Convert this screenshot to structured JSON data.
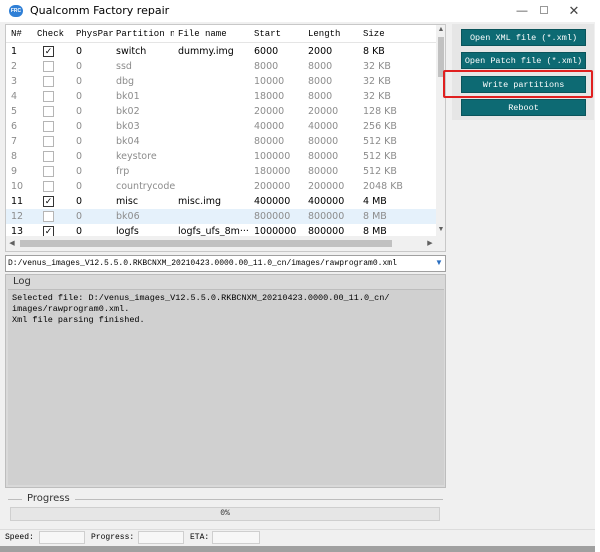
{
  "window": {
    "title": "Qualcomm Factory repair",
    "icon_text": "FRC"
  },
  "table": {
    "headers": [
      "N#",
      "Check",
      "PhysPar",
      "Partition na",
      "File name",
      "Start",
      "Length",
      "Size"
    ],
    "rows": [
      {
        "n": "1",
        "checked": true,
        "phys": "0",
        "name": "switch",
        "file": "dummy.img",
        "start": "6000",
        "length": "2000",
        "size": "8 KB",
        "dim": false
      },
      {
        "n": "2",
        "checked": false,
        "phys": "0",
        "name": "ssd",
        "file": "",
        "start": "8000",
        "length": "8000",
        "size": "32 KB",
        "dim": true
      },
      {
        "n": "3",
        "checked": false,
        "phys": "0",
        "name": "dbg",
        "file": "",
        "start": "10000",
        "length": "8000",
        "size": "32 KB",
        "dim": true
      },
      {
        "n": "4",
        "checked": false,
        "phys": "0",
        "name": "bk01",
        "file": "",
        "start": "18000",
        "length": "8000",
        "size": "32 KB",
        "dim": true
      },
      {
        "n": "5",
        "checked": false,
        "phys": "0",
        "name": "bk02",
        "file": "",
        "start": "20000",
        "length": "20000",
        "size": "128 KB",
        "dim": true
      },
      {
        "n": "6",
        "checked": false,
        "phys": "0",
        "name": "bk03",
        "file": "",
        "start": "40000",
        "length": "40000",
        "size": "256 KB",
        "dim": true
      },
      {
        "n": "7",
        "checked": false,
        "phys": "0",
        "name": "bk04",
        "file": "",
        "start": "80000",
        "length": "80000",
        "size": "512 KB",
        "dim": true
      },
      {
        "n": "8",
        "checked": false,
        "phys": "0",
        "name": "keystore",
        "file": "",
        "start": "100000",
        "length": "80000",
        "size": "512 KB",
        "dim": true
      },
      {
        "n": "9",
        "checked": false,
        "phys": "0",
        "name": "frp",
        "file": "",
        "start": "180000",
        "length": "80000",
        "size": "512 KB",
        "dim": true
      },
      {
        "n": "10",
        "checked": false,
        "phys": "0",
        "name": "countrycode",
        "file": "",
        "start": "200000",
        "length": "200000",
        "size": "2048 KB",
        "dim": true
      },
      {
        "n": "11",
        "checked": true,
        "phys": "0",
        "name": "misc",
        "file": "misc.img",
        "start": "400000",
        "length": "400000",
        "size": "4 MB",
        "dim": false
      },
      {
        "n": "12",
        "checked": false,
        "phys": "0",
        "name": "bk06",
        "file": "",
        "start": "800000",
        "length": "800000",
        "size": "8 MB",
        "dim": true,
        "selected": true
      },
      {
        "n": "13",
        "checked": true,
        "phys": "0",
        "name": "logfs",
        "file": "logfs_ufs_8m···",
        "start": "1000000",
        "length": "800000",
        "size": "8 MB",
        "dim": false
      }
    ]
  },
  "buttons": {
    "open_xml": "Open XML file (*.xml)",
    "open_patch": "Open Patch file (*.xml)",
    "write_partitions": "Write partitions",
    "reboot": "Reboot"
  },
  "path": {
    "value": "D:/venus_images_V12.5.5.0.RKBCNXM_20210423.0000.00_11.0_cn/images/rawprogram0.xml"
  },
  "log": {
    "title": "Log",
    "lines": [
      "Selected file: D:/venus_images_V12.5.5.0.RKBCNXM_20210423.0000.00_11.0_cn/",
      "images/rawprogram0.xml.",
      "Xml file parsing finished."
    ]
  },
  "progress": {
    "title": "Progress",
    "percent": 0,
    "label": "0%"
  },
  "status": {
    "speed_label": "Speed:",
    "progress_label": "Progress:",
    "eta_label": "ETA:"
  },
  "colors": {
    "button_bg": "#0d6a73",
    "highlight": "#e02020",
    "selected_row": "#e5f1fb"
  },
  "icons": {
    "dropdown": "chevron-down-icon",
    "scroll_up": "arrow-up-icon",
    "scroll_down": "arrow-down-icon"
  }
}
